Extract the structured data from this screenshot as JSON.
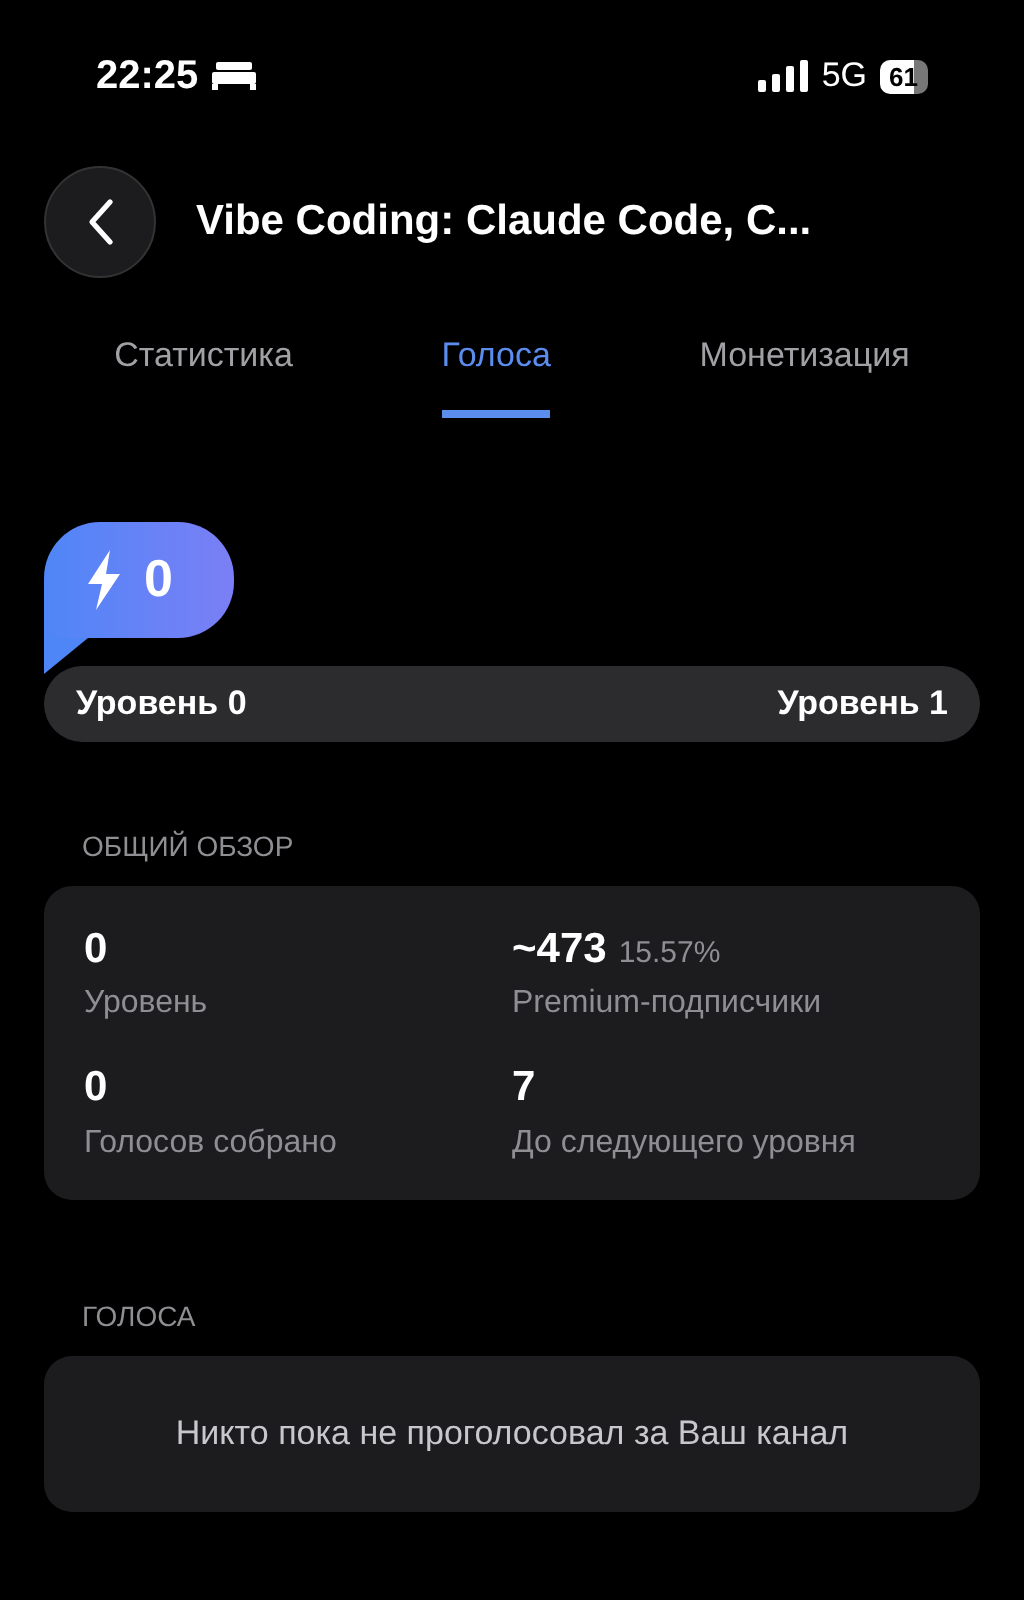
{
  "status_bar": {
    "time": "22:25",
    "network": "5G",
    "battery": "61"
  },
  "header": {
    "title": "Vibe Coding: Claude Code, C..."
  },
  "tabs": [
    {
      "label": "Статистика",
      "selected": false
    },
    {
      "label": "Голоса",
      "selected": true
    },
    {
      "label": "Монетизация",
      "selected": false
    }
  ],
  "boost_badge": {
    "count": "0"
  },
  "level_bar": {
    "current": "Уровень 0",
    "next": "Уровень 1"
  },
  "overview": {
    "title": "ОБЩИЙ ОБЗОР",
    "stats": [
      {
        "value": "0",
        "label": "Уровень"
      },
      {
        "value": "~473",
        "extra": "15.57%",
        "label": "Premium-подписчики"
      },
      {
        "value": "0",
        "label": "Голосов собрано"
      },
      {
        "value": "7",
        "label": "До следующего уровня"
      }
    ]
  },
  "votes": {
    "title": "ГОЛОСА",
    "empty_message": "Никто пока не проголосовал за Ваш канал"
  }
}
